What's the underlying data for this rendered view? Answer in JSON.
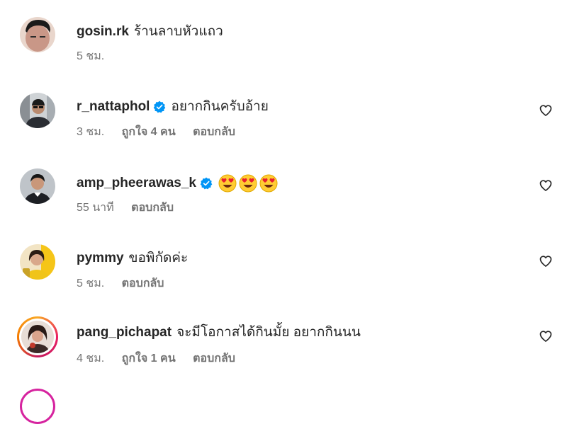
{
  "comments": [
    {
      "username": "gosin.rk",
      "verified": false,
      "text": "ร้านลาบหัวแถว",
      "time": "5 ชม.",
      "likes": "",
      "reply": "",
      "has_heart": false
    },
    {
      "username": "r_nattaphol",
      "verified": true,
      "text": "อยากกินครับอ้าย",
      "time": "3 ชม.",
      "likes": "ถูกใจ 4 คน",
      "reply": "ตอบกลับ",
      "has_heart": true
    },
    {
      "username": "amp_pheerawas_k",
      "verified": true,
      "text": "😍😍😍",
      "time": "55 นาที",
      "likes": "",
      "reply": "ตอบกลับ",
      "has_heart": true
    },
    {
      "username": "pymmy",
      "verified": false,
      "text": "ขอพิกัดค่ะ",
      "time": "5 ชม.",
      "likes": "",
      "reply": "ตอบกลับ",
      "has_heart": true
    },
    {
      "username": "pang_pichapat",
      "verified": false,
      "text": "จะมีโอกาสได้กินมั้ย อยากกินนน",
      "time": "4 ชม.",
      "likes": "ถูกใจ 1 คน",
      "reply": "ตอบกลับ",
      "has_heart": true
    }
  ],
  "colors": {
    "verified_badge": "#0095f6",
    "meta_text": "#737373",
    "primary_text": "#262626",
    "story_ring": "#d6249f"
  },
  "icons": {
    "verified": "verified-badge-icon",
    "like": "heart-outline-icon"
  }
}
